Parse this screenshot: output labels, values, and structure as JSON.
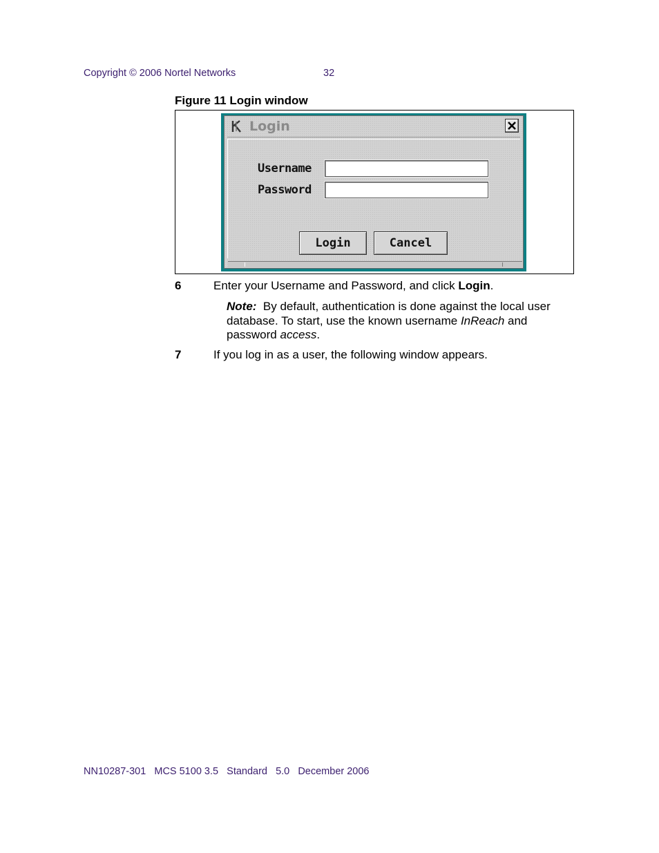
{
  "header": {
    "copyright": "Copyright © 2006 Nortel Networks",
    "page_number": "32"
  },
  "figure": {
    "caption": "Figure 11  Login window"
  },
  "dialog": {
    "title": "Login",
    "username_label": "Username",
    "password_label": "Password",
    "username_value": "",
    "password_value": "",
    "login_button": "Login",
    "cancel_button": "Cancel",
    "accent_color": "#0f7f83"
  },
  "steps": [
    {
      "number": "6",
      "text_before": "Enter your Username and Password, and click ",
      "text_bold": "Login",
      "text_after": "."
    },
    {
      "number": "7",
      "text": "If you log in as a user, the following window appears."
    }
  ],
  "note": {
    "label": "Note:",
    "part1": "By default, authentication is done against the local user database. To start, use the known username ",
    "username": "InReach",
    "part2": " and password ",
    "password": "access",
    "part3": "."
  },
  "footer": {
    "text": "NN10287-301   MCS 5100 3.5   Standard   5.0   December 2006"
  }
}
